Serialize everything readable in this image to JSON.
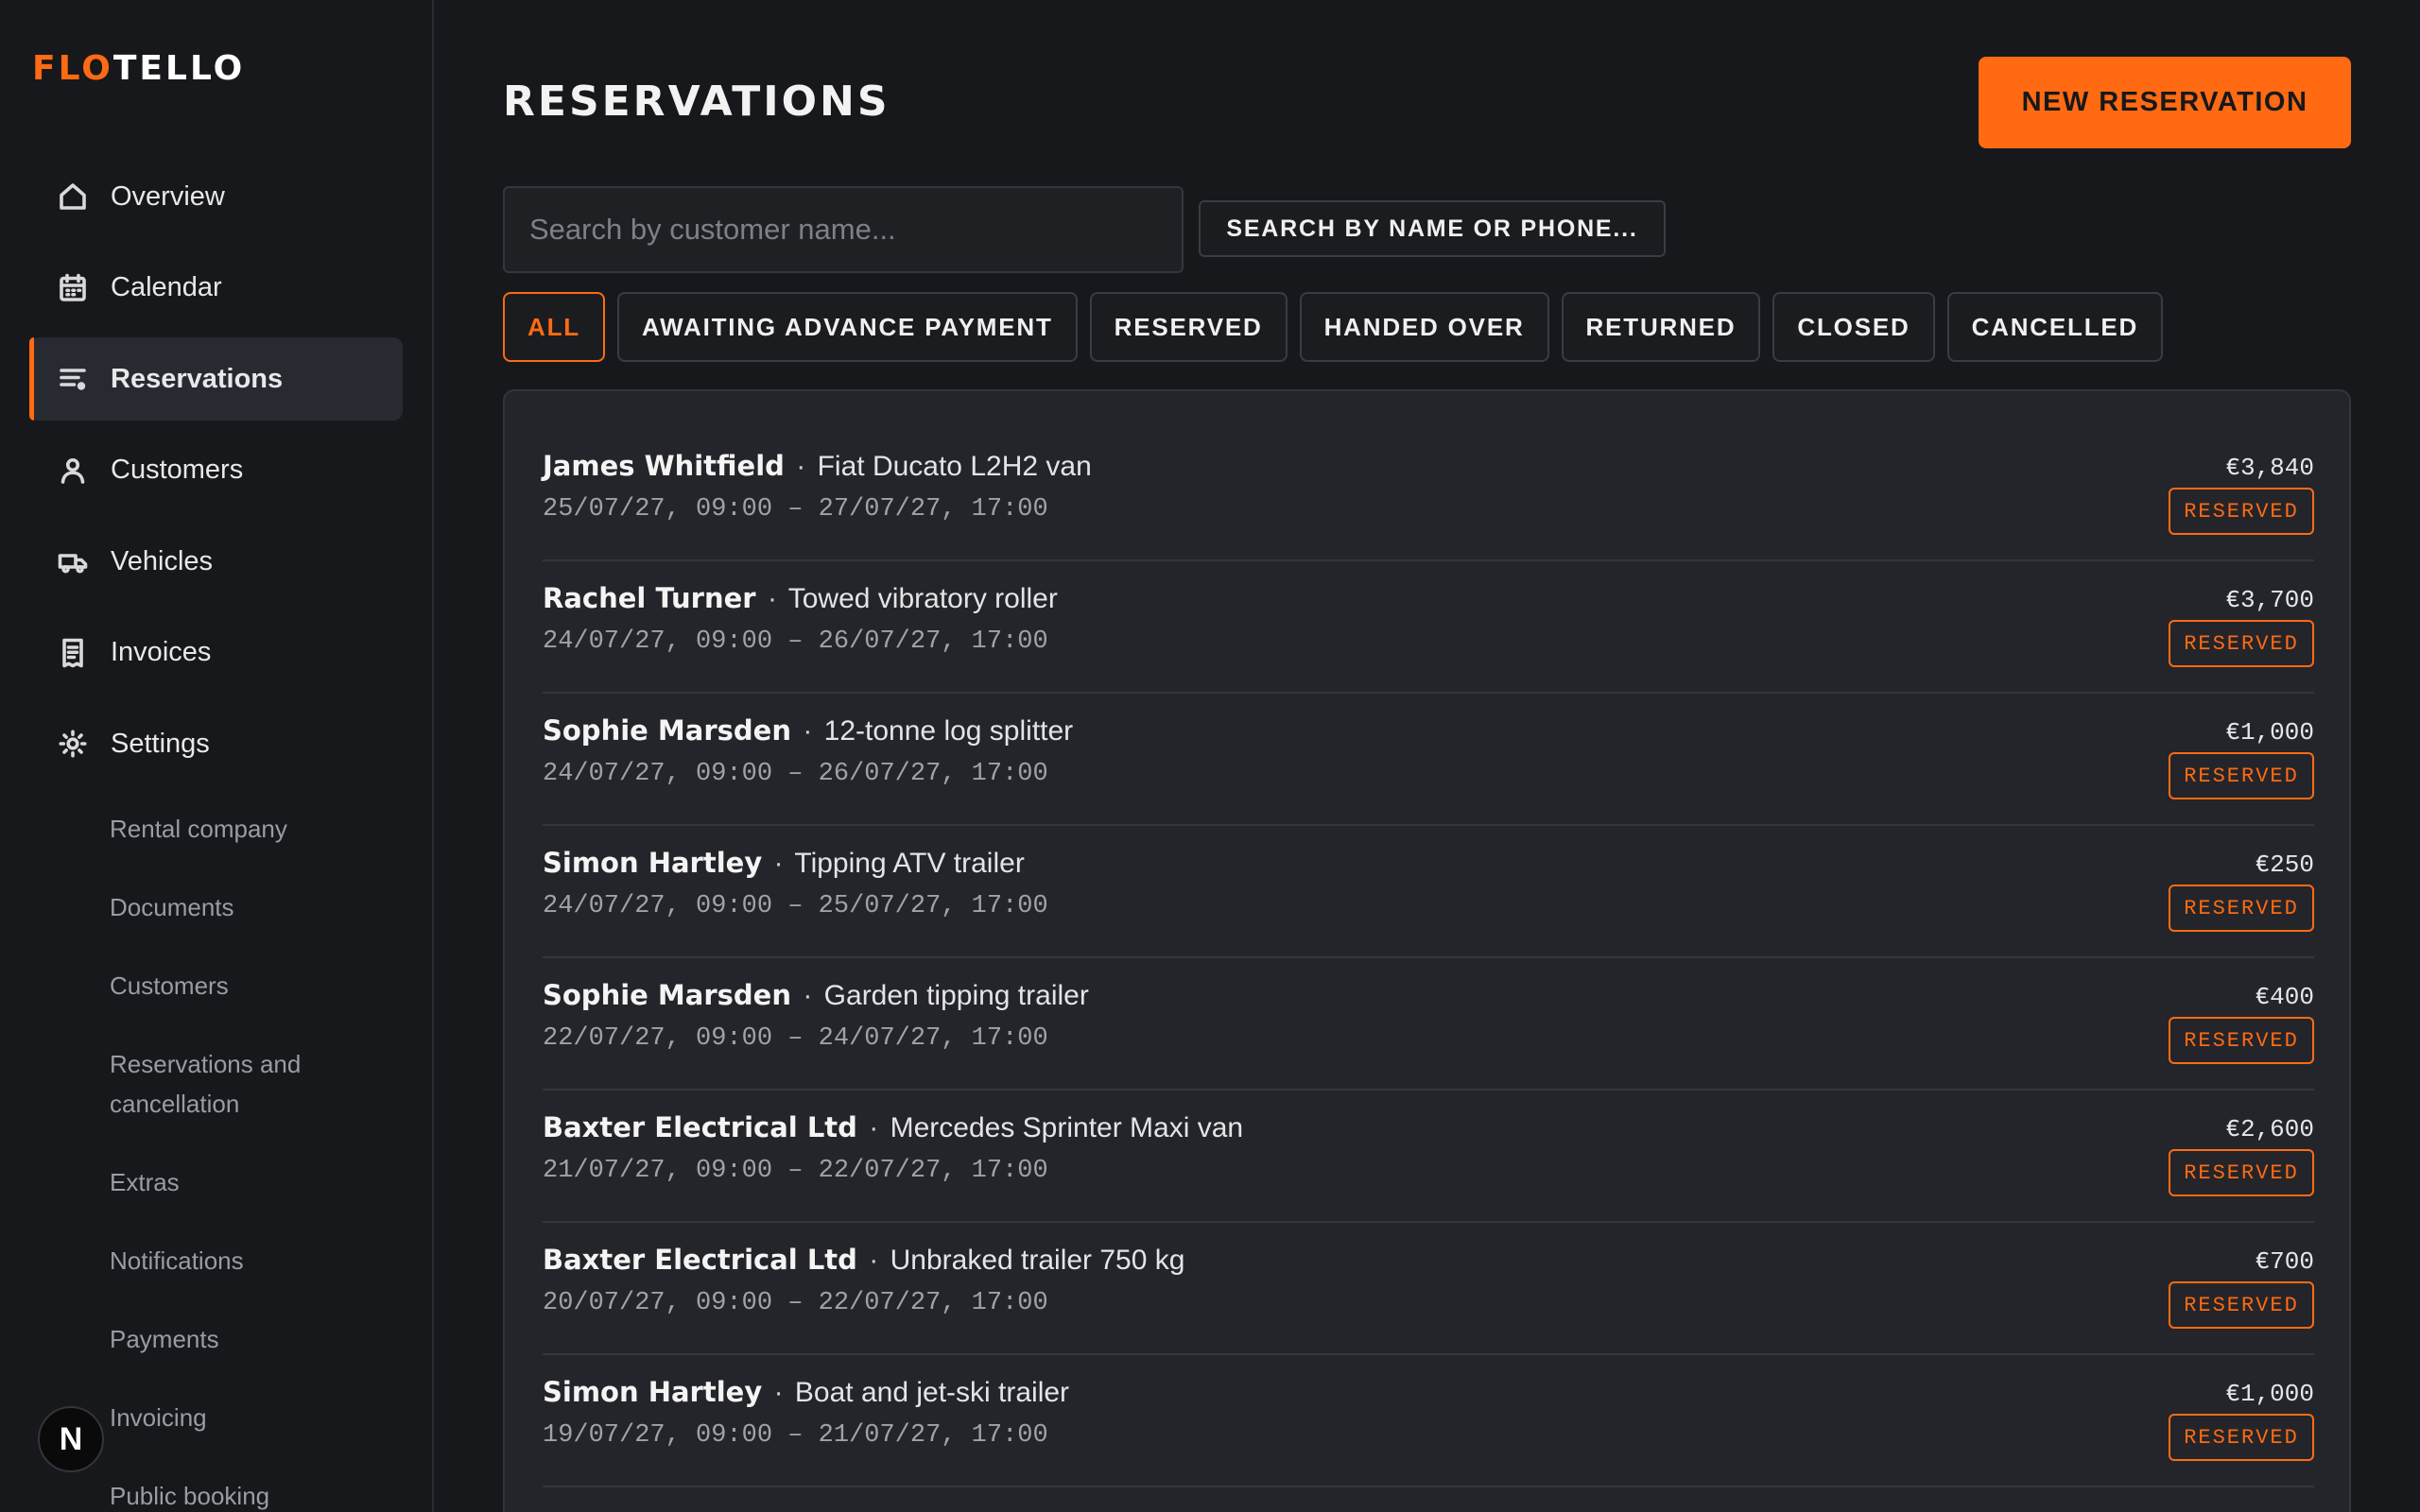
{
  "app": {
    "logo_part1": "FLO",
    "logo_part2": "TELLO",
    "brand_color": "#ff6a13"
  },
  "sidebar": {
    "items": [
      {
        "label": "Overview",
        "icon": "home-icon"
      },
      {
        "label": "Calendar",
        "icon": "calendar-icon"
      },
      {
        "label": "Reservations",
        "icon": "list-icon",
        "active": true
      },
      {
        "label": "Customers",
        "icon": "user-icon"
      },
      {
        "label": "Vehicles",
        "icon": "truck-icon"
      },
      {
        "label": "Invoices",
        "icon": "receipt-icon"
      },
      {
        "label": "Settings",
        "icon": "gear-icon"
      }
    ],
    "settings_sub": [
      "Rental company",
      "Documents",
      "Customers",
      "Reservations and cancellation",
      "Extras",
      "Notifications",
      "Payments",
      "Invoicing",
      "Public booking"
    ],
    "avatar_letter": "N"
  },
  "header": {
    "title": "RESERVATIONS",
    "new_button": "NEW RESERVATION"
  },
  "search": {
    "placeholder": "Search by customer name...",
    "value": "",
    "button": "SEARCH BY NAME OR PHONE..."
  },
  "filters": [
    {
      "label": "ALL",
      "active": true
    },
    {
      "label": "AWAITING ADVANCE PAYMENT"
    },
    {
      "label": "RESERVED"
    },
    {
      "label": "HANDED OVER"
    },
    {
      "label": "RETURNED"
    },
    {
      "label": "CLOSED"
    },
    {
      "label": "CANCELLED"
    }
  ],
  "reservations": [
    {
      "customer": "James Whitfield",
      "vehicle": "Fiat Ducato L2H2 van",
      "dates": "25/07/27, 09:00 – 27/07/27, 17:00",
      "price": "€3,840",
      "status": "RESERVED"
    },
    {
      "customer": "Rachel Turner",
      "vehicle": "Towed vibratory roller",
      "dates": "24/07/27, 09:00 – 26/07/27, 17:00",
      "price": "€3,700",
      "status": "RESERVED"
    },
    {
      "customer": "Sophie Marsden",
      "vehicle": "12-tonne log splitter",
      "dates": "24/07/27, 09:00 – 26/07/27, 17:00",
      "price": "€1,000",
      "status": "RESERVED"
    },
    {
      "customer": "Simon Hartley",
      "vehicle": "Tipping ATV trailer",
      "dates": "24/07/27, 09:00 – 25/07/27, 17:00",
      "price": "€250",
      "status": "RESERVED"
    },
    {
      "customer": "Sophie Marsden",
      "vehicle": "Garden tipping trailer",
      "dates": "22/07/27, 09:00 – 24/07/27, 17:00",
      "price": "€400",
      "status": "RESERVED"
    },
    {
      "customer": "Baxter Electrical Ltd",
      "vehicle": "Mercedes Sprinter Maxi van",
      "dates": "21/07/27, 09:00 – 22/07/27, 17:00",
      "price": "€2,600",
      "status": "RESERVED"
    },
    {
      "customer": "Baxter Electrical Ltd",
      "vehicle": "Unbraked trailer 750 kg",
      "dates": "20/07/27, 09:00 – 22/07/27, 17:00",
      "price": "€700",
      "status": "RESERVED"
    },
    {
      "customer": "Simon Hartley",
      "vehicle": "Boat and jet-ski trailer",
      "dates": "19/07/27, 09:00 – 21/07/27, 17:00",
      "price": "€1,000",
      "status": "RESERVED"
    }
  ],
  "row_separator": "·"
}
